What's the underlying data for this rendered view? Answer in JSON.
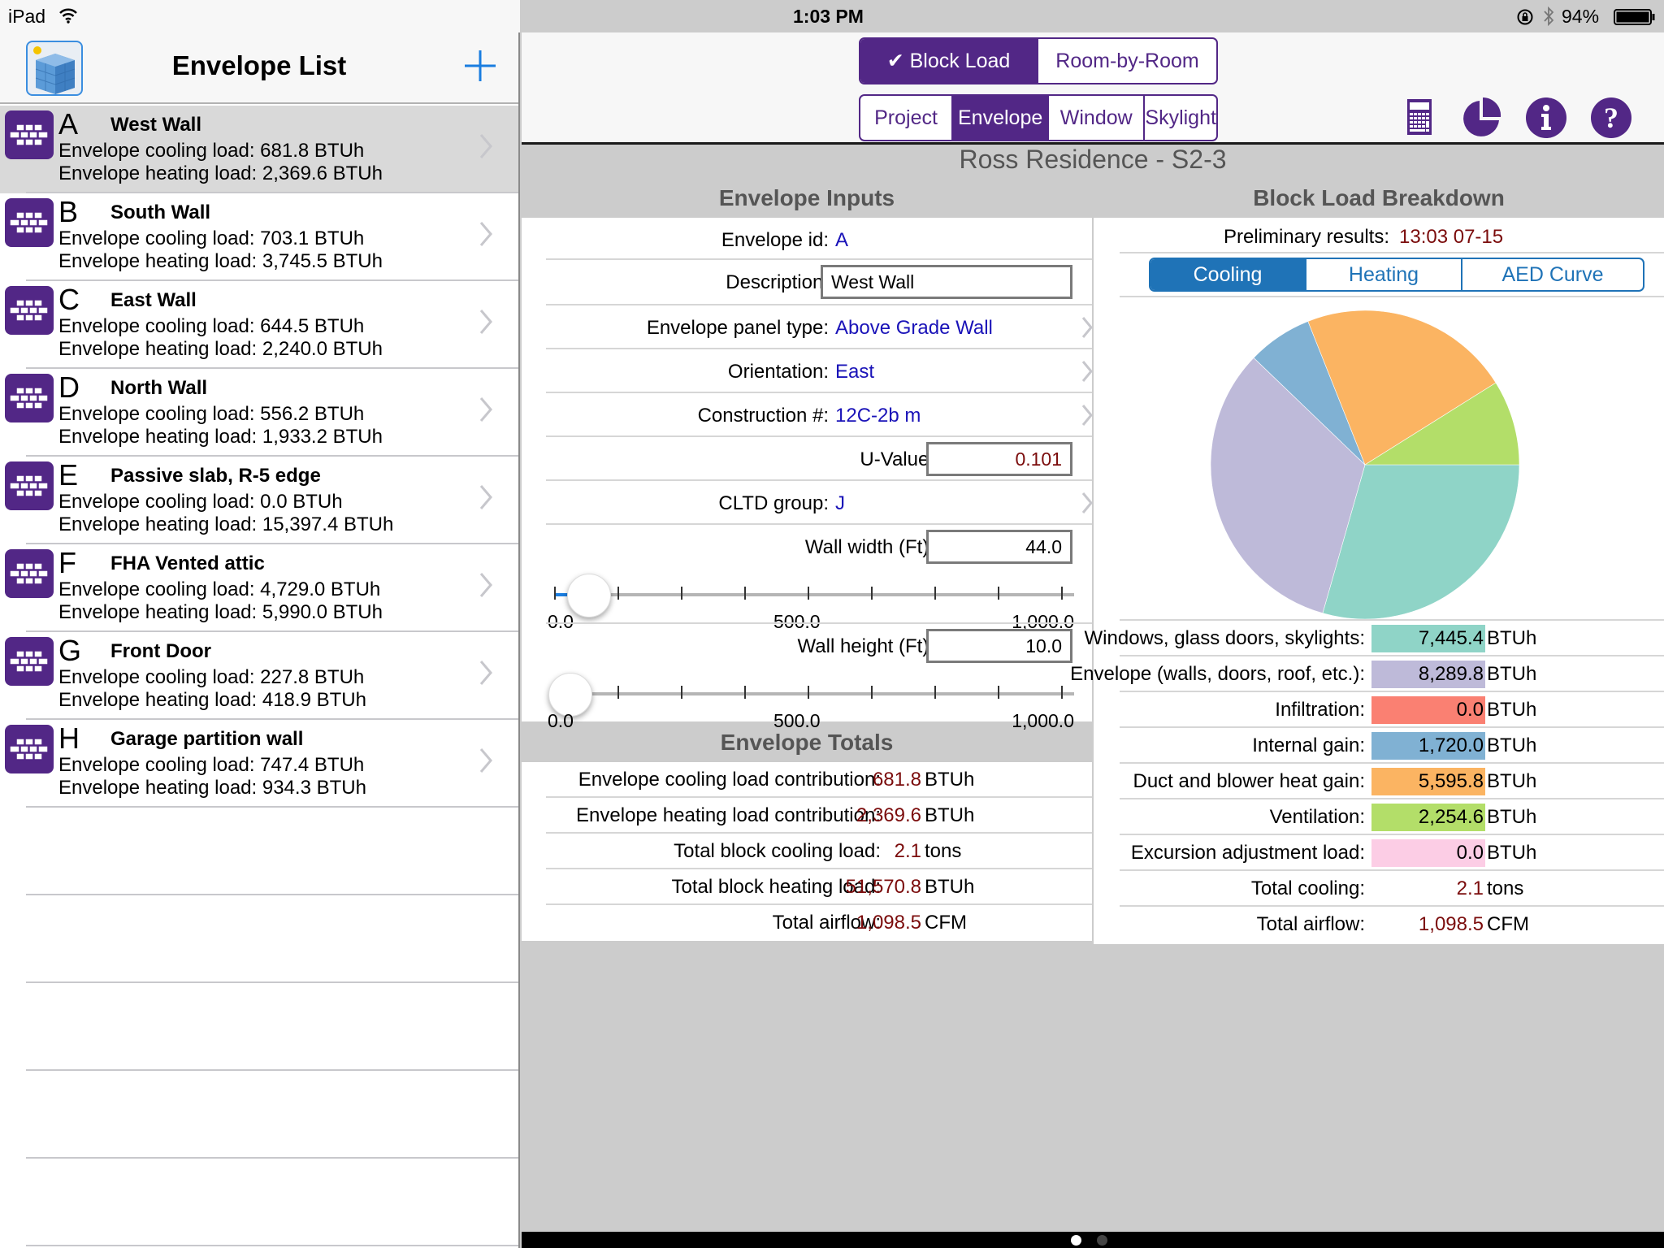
{
  "status_bar": {
    "device": "iPad",
    "time": "1:03 PM",
    "battery": "94%"
  },
  "left_panel": {
    "title": "Envelope List",
    "add_icon": "plus-icon",
    "items": [
      {
        "letter": "A",
        "name": "West Wall",
        "cooling": "Envelope cooling load: 681.8 BTUh",
        "heating": "Envelope heating load: 2,369.6 BTUh",
        "selected": true
      },
      {
        "letter": "B",
        "name": "South Wall",
        "cooling": "Envelope cooling load: 703.1 BTUh",
        "heating": "Envelope heating load: 3,745.5 BTUh"
      },
      {
        "letter": "C",
        "name": "East Wall",
        "cooling": "Envelope cooling load: 644.5 BTUh",
        "heating": "Envelope heating load: 2,240.0 BTUh"
      },
      {
        "letter": "D",
        "name": "North Wall",
        "cooling": "Envelope cooling load: 556.2 BTUh",
        "heating": "Envelope heating load: 1,933.2 BTUh"
      },
      {
        "letter": "E",
        "name": "Passive slab, R-5 edge",
        "cooling": "Envelope cooling load: 0.0 BTUh",
        "heating": "Envelope heating load: 15,397.4 BTUh"
      },
      {
        "letter": "F",
        "name": "FHA Vented attic",
        "cooling": "Envelope cooling load: 4,729.0 BTUh",
        "heating": "Envelope heating load: 5,990.0 BTUh"
      },
      {
        "letter": "G",
        "name": "Front Door",
        "cooling": "Envelope cooling load: 227.8 BTUh",
        "heating": "Envelope heating load: 418.9 BTUh"
      },
      {
        "letter": "H",
        "name": "Garage partition wall",
        "cooling": "Envelope cooling load: 747.4 BTUh",
        "heating": "Envelope heating load: 934.3 BTUh"
      }
    ]
  },
  "top_bar": {
    "mode_tabs": [
      {
        "label": "✔ Block Load",
        "active": true
      },
      {
        "label": "Room-by-Room",
        "active": false
      }
    ],
    "section_tabs": [
      {
        "label": "Project",
        "active": false
      },
      {
        "label": "Envelope",
        "active": true
      },
      {
        "label": "Window",
        "active": false
      },
      {
        "label": "Skylight",
        "active": false
      }
    ],
    "tools": [
      "calculator-icon",
      "pie-chart-icon",
      "info-icon",
      "help-icon"
    ]
  },
  "project_title": "Ross Residence - S2-3",
  "envelope_inputs": {
    "heading": "Envelope Inputs",
    "id_label": "Envelope id:",
    "id_value": "A",
    "description_label": "Description:",
    "description_value": "West Wall",
    "panel_type_label": "Envelope panel type:",
    "panel_type_value": "Above Grade Wall",
    "orientation_label": "Orientation:",
    "orientation_value": "East",
    "construction_label": "Construction #:",
    "construction_value": "12C-2b m",
    "u_value_label": "U-Value:",
    "u_value": "0.101",
    "cltd_label": "CLTD group:",
    "cltd_value": "J",
    "wall_width_label": "Wall width (Ft):",
    "wall_width_value": "44.0",
    "wall_width_slider": {
      "min": 0,
      "max": 1000,
      "value": 44,
      "min_label": "0.0",
      "mid_label": "500.0",
      "max_label": "1,000.0"
    },
    "wall_height_label": "Wall height (Ft):",
    "wall_height_value": "10.0",
    "wall_height_slider": {
      "min": 0,
      "max": 1000,
      "value": 10,
      "min_label": "0.0",
      "mid_label": "500.0",
      "max_label": "1,000.0"
    }
  },
  "envelope_totals": {
    "heading": "Envelope Totals",
    "rows": [
      {
        "label": "Envelope cooling load contribution:",
        "value": "681.8",
        "unit": "BTUh"
      },
      {
        "label": "Envelope heating load contribution:",
        "value": "2,369.6",
        "unit": "BTUh"
      },
      {
        "label": "Total block cooling load:",
        "value": "2.1",
        "unit": "tons"
      },
      {
        "label": "Total block heating load:",
        "value": "51,570.8",
        "unit": "BTUh"
      },
      {
        "label": "Total airflow:",
        "value": "1,098.5",
        "unit": "CFM"
      }
    ]
  },
  "breakdown": {
    "heading": "Block Load Breakdown",
    "preliminary_label": "Preliminary results:",
    "preliminary_value": "13:03 07-15",
    "tabs": [
      {
        "label": "Cooling",
        "active": true
      },
      {
        "label": "Heating",
        "active": false
      },
      {
        "label": "AED Curve",
        "active": false
      }
    ],
    "rows": [
      {
        "label": "Windows, glass doors, skylights:",
        "value": "7,445.4",
        "unit": "BTUh",
        "color": "#8fd4c7"
      },
      {
        "label": "Envelope (walls, doors, roof, etc.):",
        "value": "8,289.8",
        "unit": "BTUh",
        "color": "#bebad9"
      },
      {
        "label": "Infiltration:",
        "value": "0.0",
        "unit": "BTUh",
        "color": "#fa8072"
      },
      {
        "label": "Internal gain:",
        "value": "1,720.0",
        "unit": "BTUh",
        "color": "#80b1d3"
      },
      {
        "label": "Duct and blower heat gain:",
        "value": "5,595.8",
        "unit": "BTUh",
        "color": "#fbb462"
      },
      {
        "label": "Ventilation:",
        "value": "2,254.6",
        "unit": "BTUh",
        "color": "#b3de69"
      },
      {
        "label": "Excursion adjustment load:",
        "value": "0.0",
        "unit": "BTUh",
        "color": "#fccde5"
      }
    ],
    "totals": [
      {
        "label": "Total cooling:",
        "value": "2.1",
        "unit": "tons"
      },
      {
        "label": "Total airflow:",
        "value": "1,098.5",
        "unit": "CFM"
      }
    ]
  },
  "chart_data": {
    "type": "pie",
    "title": "Block Load Breakdown - Cooling",
    "categories": [
      "Windows, glass doors, skylights",
      "Envelope (walls, doors, roof, etc.)",
      "Infiltration",
      "Internal gain",
      "Duct and blower heat gain",
      "Ventilation",
      "Excursion adjustment load"
    ],
    "values": [
      7445.4,
      8289.8,
      0.0,
      1720.0,
      5595.8,
      2254.6,
      0.0
    ],
    "colors": [
      "#8fd4c7",
      "#bebad9",
      "#fa8072",
      "#80b1d3",
      "#fbb462",
      "#b3de69",
      "#fccde5"
    ],
    "unit": "BTUh",
    "direction": "clockwise from 3 o'clock",
    "legend": "table-below"
  },
  "page_indicator": {
    "pages": 2,
    "current": 1
  }
}
